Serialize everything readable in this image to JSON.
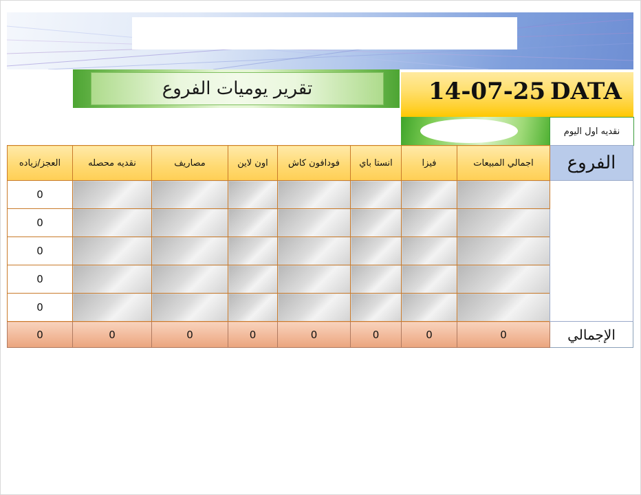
{
  "header": {
    "title": "تقرير يوميات الفروع",
    "date_label": "DATA",
    "date_value": "14-07-25"
  },
  "opening_cash": {
    "label": "نقديه اول اليوم",
    "value": ""
  },
  "table": {
    "columns": [
      "العجز/زياده",
      "نقديه محصله",
      "مصاريف",
      "اون لاين",
      "فودافون كاش",
      "انستا باي",
      "فيزا",
      "اجمالي المبيعات"
    ],
    "branch_header": "الفروع",
    "rows": [
      {
        "diff": "0"
      },
      {
        "diff": "0"
      },
      {
        "diff": "0"
      },
      {
        "diff": "0"
      },
      {
        "diff": "0"
      }
    ],
    "totals": {
      "label": "الإجمالي",
      "values": [
        "0",
        "0",
        "0",
        "0",
        "0",
        "0",
        "0",
        "0"
      ]
    }
  },
  "colors": {
    "header_fill": "#ffd970",
    "branch_header_fill": "#b9cbea",
    "total_fill": "#f1b797",
    "title_green": "#4da533",
    "cell_border": "#c97a2a"
  }
}
